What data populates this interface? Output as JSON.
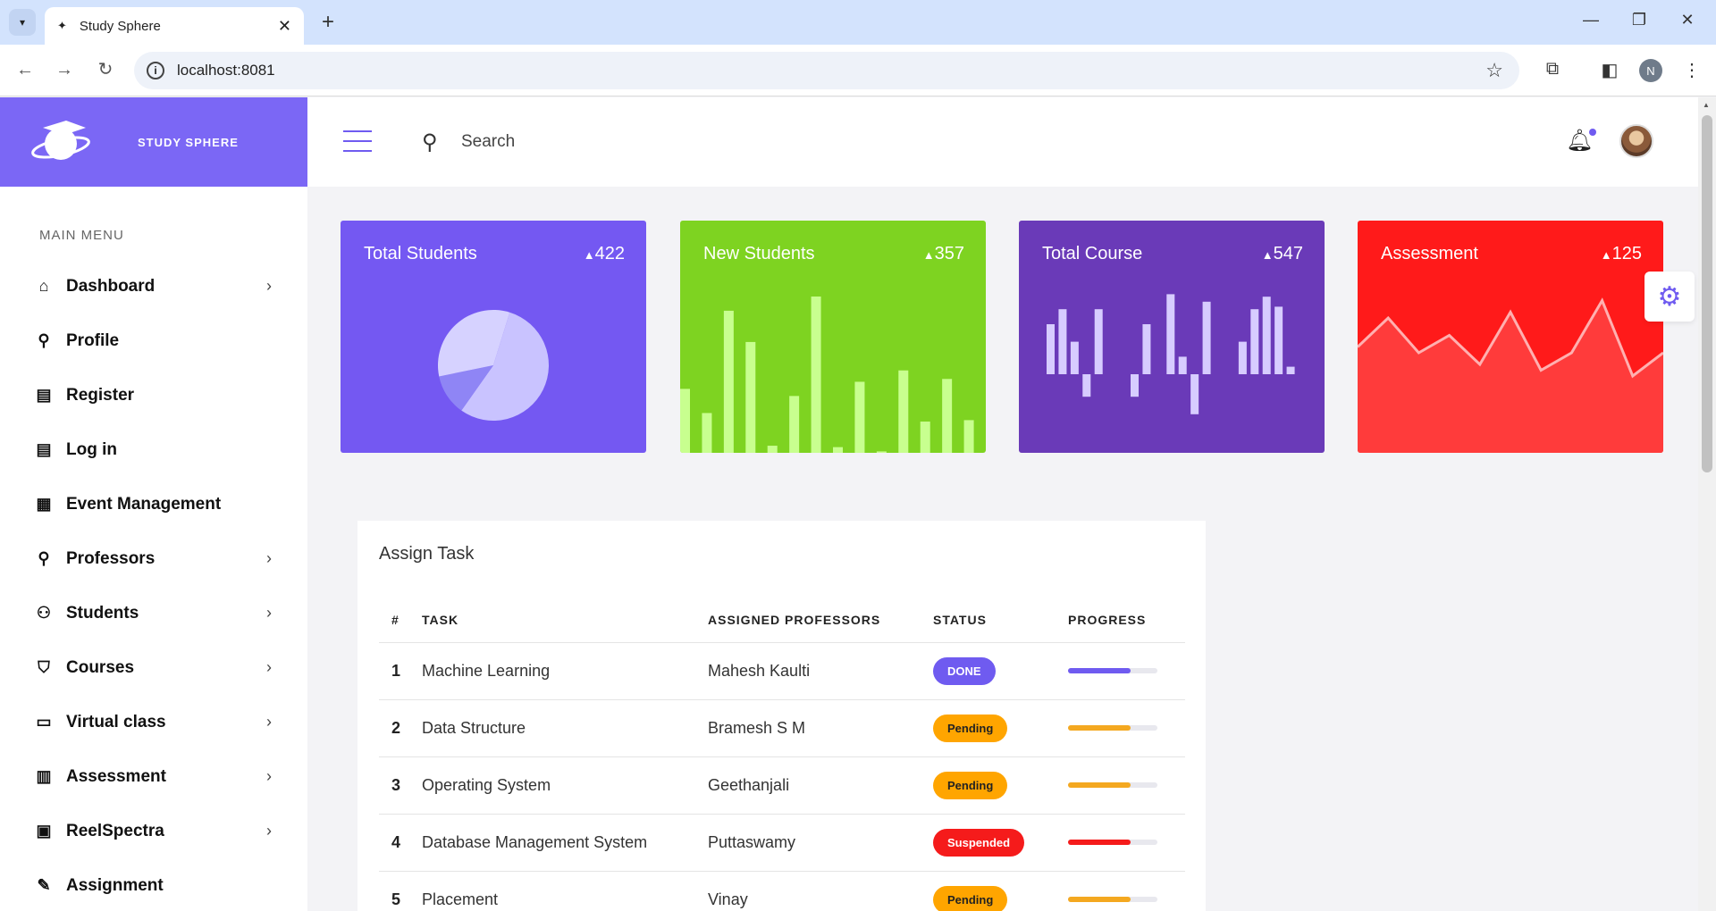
{
  "browser": {
    "tab_title": "Study Sphere",
    "url": "localhost:8081",
    "profile_initial": "N"
  },
  "brand": {
    "name": "STUDY SPHERE"
  },
  "sidebar": {
    "menu_title": "MAIN MENU",
    "items": [
      {
        "label": "Dashboard",
        "icon": "home-icon",
        "glyph": "⌂",
        "chevron": true
      },
      {
        "label": "Profile",
        "icon": "user-icon",
        "glyph": "⚲",
        "chevron": false
      },
      {
        "label": "Register",
        "icon": "table-icon",
        "glyph": "▤",
        "chevron": false
      },
      {
        "label": "Log in",
        "icon": "table-icon",
        "glyph": "▤",
        "chevron": false
      },
      {
        "label": "Event Management",
        "icon": "calendar-icon",
        "glyph": "▦",
        "chevron": false
      },
      {
        "label": "Professors",
        "icon": "user-icon",
        "glyph": "⚲",
        "chevron": true
      },
      {
        "label": "Students",
        "icon": "users-icon",
        "glyph": "⚇",
        "chevron": true
      },
      {
        "label": "Courses",
        "icon": "graduation-cap-icon",
        "glyph": "⛉",
        "chevron": true
      },
      {
        "label": "Virtual class",
        "icon": "laptop-icon",
        "glyph": "▭",
        "chevron": true
      },
      {
        "label": "Assessment",
        "icon": "document-icon",
        "glyph": "▥",
        "chevron": true
      },
      {
        "label": "ReelSpectra",
        "icon": "film-icon",
        "glyph": "▣",
        "chevron": true
      },
      {
        "label": "Assignment",
        "icon": "edit-icon",
        "glyph": "✎",
        "chevron": false
      }
    ]
  },
  "topbar": {
    "search_label": "Search"
  },
  "cards": [
    {
      "title": "Total Students",
      "count": "422",
      "color": "#7458f2"
    },
    {
      "title": "New Students",
      "count": "357",
      "color": "#7ed321"
    },
    {
      "title": "Total Course",
      "count": "547",
      "color": "#6a3ab8"
    },
    {
      "title": "Assessment",
      "count": "125",
      "color": "#ff1a1a"
    }
  ],
  "mini_charts": {
    "pie": [
      0.55,
      0.12,
      0.33
    ],
    "new_students_bars": [
      45,
      28,
      100,
      78,
      5,
      40,
      110,
      4,
      50,
      1,
      58,
      22,
      52,
      23
    ],
    "course_bars": [
      40,
      52,
      26,
      -18,
      52,
      0,
      0,
      -18,
      40,
      0,
      64,
      14,
      -32,
      58,
      0,
      0,
      26,
      52,
      62,
      54,
      6
    ],
    "assessment_line": [
      55,
      30,
      60,
      45,
      70,
      25,
      75,
      60,
      15,
      80,
      60
    ]
  },
  "tasks": {
    "title": "Assign Task",
    "headers": [
      "#",
      "TASK",
      "ASSIGNED PROFESSORS",
      "STATUS",
      "PROGRESS"
    ],
    "rows": [
      {
        "num": "1",
        "task": "Machine Learning",
        "professor": "Mahesh Kaulti",
        "status": "DONE",
        "status_color": "#6f5bf0",
        "status_text_color": "#ffffff",
        "progress": 0.7,
        "progress_color": "#6f5bf0"
      },
      {
        "num": "2",
        "task": "Data Structure",
        "professor": "Bramesh S M",
        "status": "Pending",
        "status_color": "#ffa500",
        "status_text_color": "#222222",
        "progress": 0.7,
        "progress_color": "#f4a820"
      },
      {
        "num": "3",
        "task": "Operating System",
        "professor": "Geethanjali",
        "status": "Pending",
        "status_color": "#ffa500",
        "status_text_color": "#222222",
        "progress": 0.7,
        "progress_color": "#f4a820"
      },
      {
        "num": "4",
        "task": "Database Management System",
        "professor": "Puttaswamy",
        "status": "Suspended",
        "status_color": "#f51b1b",
        "status_text_color": "#ffffff",
        "progress": 0.7,
        "progress_color": "#f51b1b"
      },
      {
        "num": "5",
        "task": "Placement",
        "professor": "Vinay",
        "status": "Pending",
        "status_color": "#ffa500",
        "status_text_color": "#222222",
        "progress": 0.7,
        "progress_color": "#f4a820"
      }
    ]
  }
}
